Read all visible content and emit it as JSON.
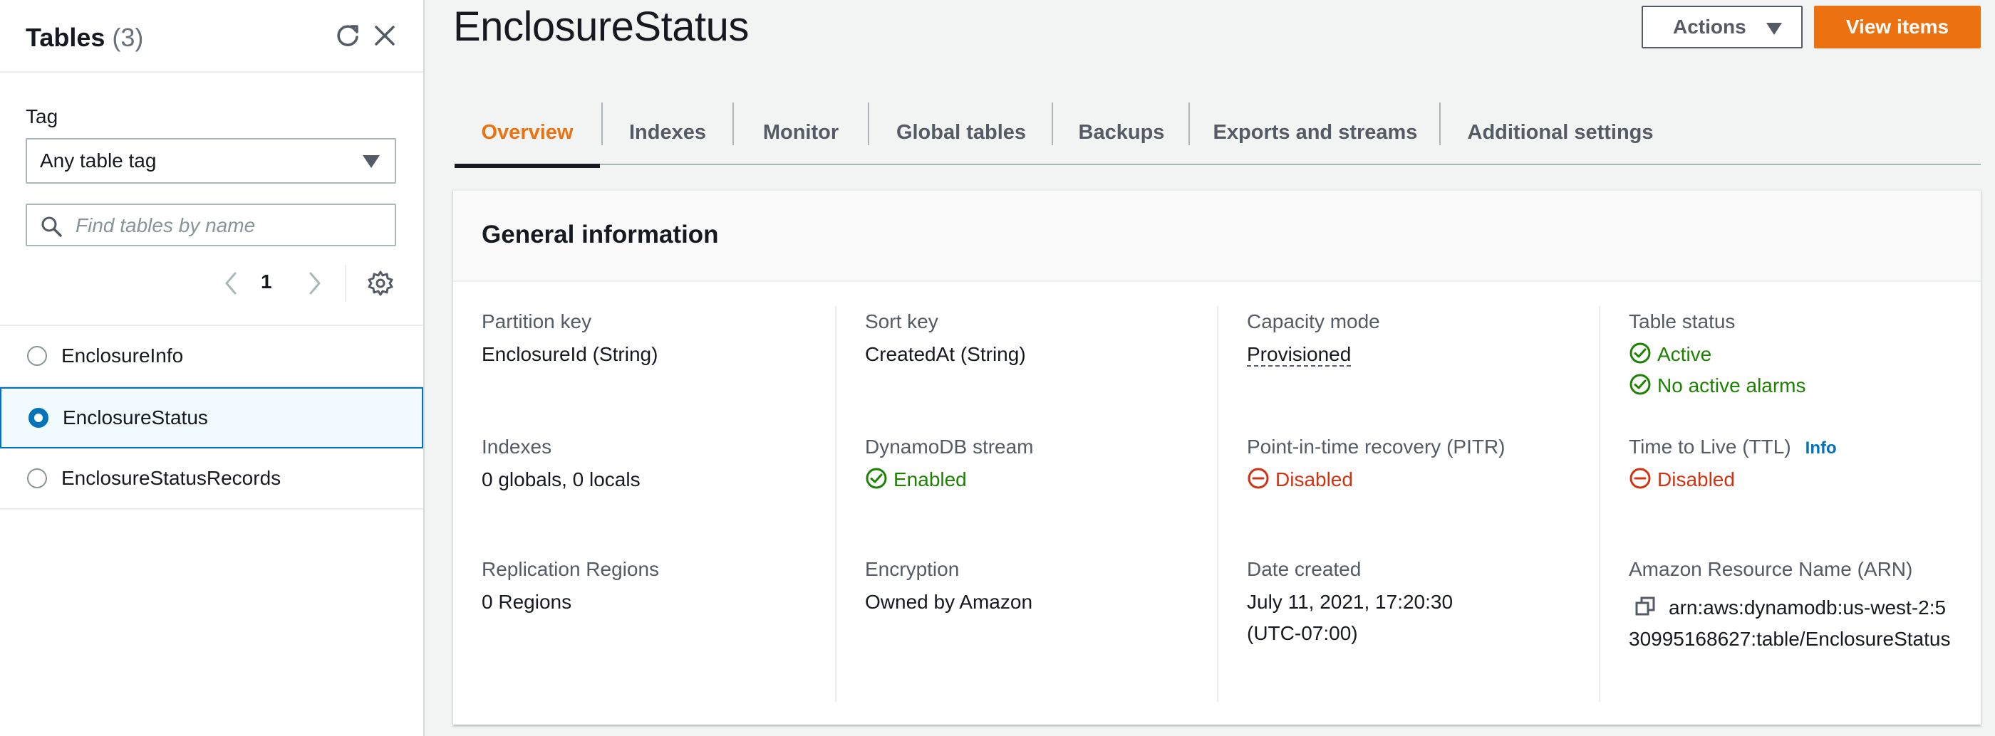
{
  "sidebar": {
    "title": "Tables",
    "count": "(3)",
    "tag_label": "Tag",
    "tag_value": "Any table tag",
    "search_placeholder": "Find tables by name",
    "page": "1",
    "tables": [
      {
        "name": "EnclosureInfo",
        "selected": false
      },
      {
        "name": "EnclosureStatus",
        "selected": true
      },
      {
        "name": "EnclosureStatusRecords",
        "selected": false
      }
    ]
  },
  "header": {
    "title": "EnclosureStatus",
    "actions_label": "Actions",
    "view_items_label": "View items"
  },
  "tabs": [
    "Overview",
    "Indexes",
    "Monitor",
    "Global tables",
    "Backups",
    "Exports and streams",
    "Additional settings"
  ],
  "general": {
    "title": "General information",
    "partition_key_label": "Partition key",
    "partition_key_value": "EnclosureId (String)",
    "sort_key_label": "Sort key",
    "sort_key_value": "CreatedAt (String)",
    "capacity_mode_label": "Capacity mode",
    "capacity_mode_value": "Provisioned",
    "table_status_label": "Table status",
    "table_status_value": "Active",
    "alarms_value": "No active alarms",
    "indexes_label": "Indexes",
    "indexes_value": "0 globals, 0 locals",
    "stream_label": "DynamoDB stream",
    "stream_value": "Enabled",
    "pitr_label": "Point-in-time recovery (PITR)",
    "pitr_value": "Disabled",
    "ttl_label": "Time to Live (TTL)",
    "ttl_info": "Info",
    "ttl_value": "Disabled",
    "replication_label": "Replication Regions",
    "replication_value": "0 Regions",
    "encryption_label": "Encryption",
    "encryption_value": "Owned by Amazon",
    "date_created_label": "Date created",
    "date_created_line1": "July 11, 2021, 17:20:30",
    "date_created_line2": "(UTC-07:00)",
    "arn_label": "Amazon Resource Name (ARN)",
    "arn_value": "arn:aws:dynamodb:us-west-2:530995168627:table/EnclosureStatus"
  },
  "colors": {
    "accent": "#ec7211",
    "link": "#0073bb",
    "success": "#1d8102",
    "error": "#d13212"
  }
}
